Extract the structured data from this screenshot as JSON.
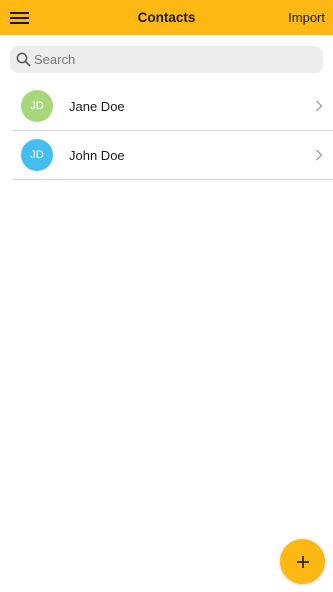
{
  "header": {
    "title": "Contacts",
    "import_label": "Import",
    "menu_icon": "hamburger-menu-icon",
    "background_color": "#fdb813"
  },
  "search": {
    "placeholder": "Search",
    "value": "",
    "icon": "search-icon"
  },
  "contacts": [
    {
      "initials": "JD",
      "name": "Jane Doe",
      "avatar_color": "#a8d67a"
    },
    {
      "initials": "JD",
      "name": "John Doe",
      "avatar_color": "#45bdf0"
    }
  ],
  "fab": {
    "icon": "plus-icon",
    "color": "#fdb813"
  }
}
